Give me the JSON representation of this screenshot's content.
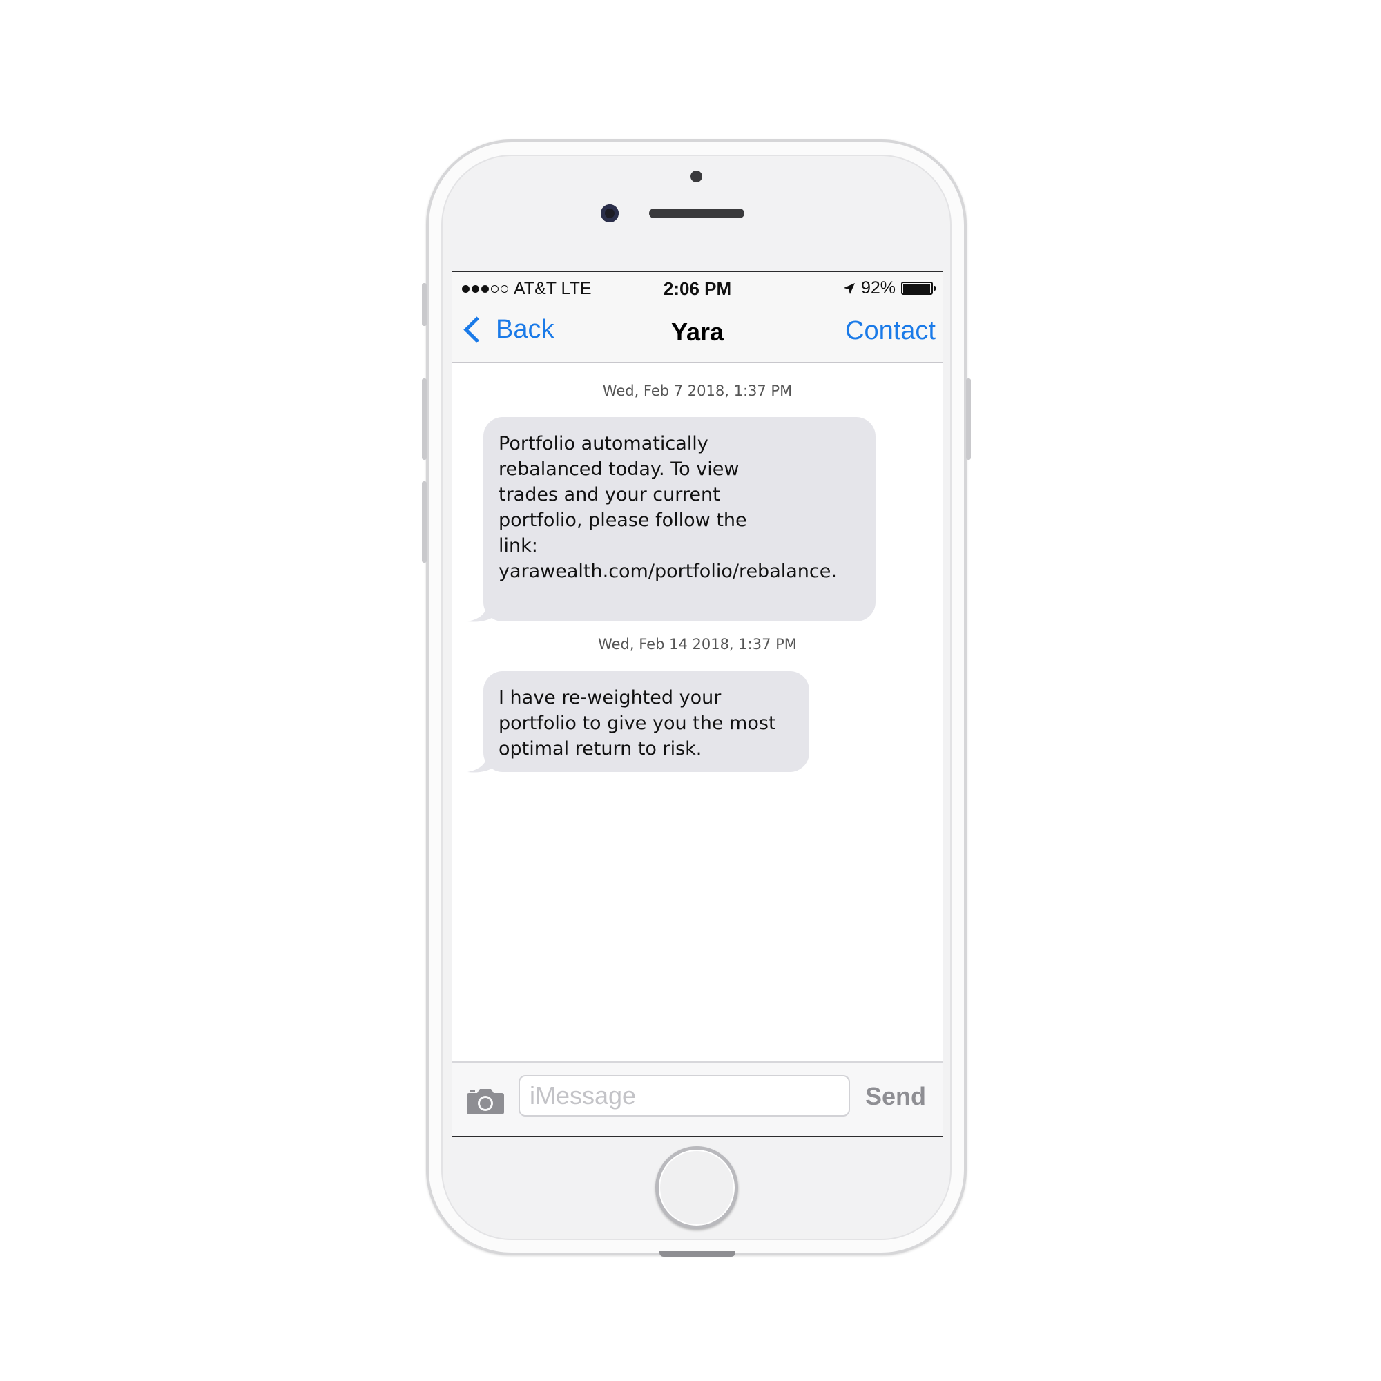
{
  "status_bar": {
    "carrier": "AT&T LTE",
    "time": "2:06 PM",
    "battery": "92%",
    "battery_level": 0.92,
    "signal_bars_filled": 3,
    "signal_bars_total": 5
  },
  "nav": {
    "back_label": "Back",
    "title": "Yara",
    "contact_label": "Contact"
  },
  "conversation": [
    {
      "timestamp": "Wed, Feb 7 2018, 1:37 PM",
      "lines": [
        "Portfolio automatically",
        "rebalanced today. To view",
        "trades and your current",
        "portfolio, please follow the",
        "link:",
        "yarawealth.com/portfolio/rebalance."
      ]
    },
    {
      "timestamp": "Wed, Feb 14 2018, 1:37 PM",
      "lines": [
        "I have re-weighted your",
        "portfolio to give you the most",
        "optimal return to risk."
      ]
    }
  ],
  "composer": {
    "placeholder": "iMessage",
    "send_label": "Send"
  },
  "colors": {
    "accent": "#1a7ae8",
    "bubble": "#e5e5ea",
    "send_disabled": "#8e8e93"
  },
  "icons": [
    "location-arrow-icon",
    "chevron-left-icon",
    "camera-icon"
  ]
}
